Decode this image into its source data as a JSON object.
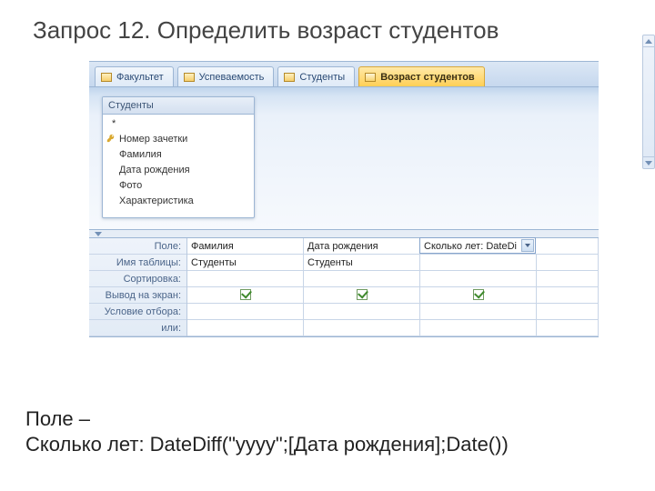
{
  "slide_title": "Запрос 12. Определить возраст студентов",
  "tabs": [
    {
      "label": "Факультет",
      "icon": "table-icon",
      "active": false
    },
    {
      "label": "Успеваемость",
      "icon": "table-icon",
      "active": false
    },
    {
      "label": "Студенты",
      "icon": "table-icon",
      "active": false
    },
    {
      "label": "Возраст студентов",
      "icon": "query-icon",
      "active": true
    }
  ],
  "source_table": {
    "title": "Студенты",
    "fields": [
      {
        "label": "*",
        "pk": false,
        "star": true
      },
      {
        "label": "Номер зачетки",
        "pk": true
      },
      {
        "label": "Фамилия",
        "pk": false
      },
      {
        "label": "Дата рождения",
        "pk": false
      },
      {
        "label": "Фото",
        "pk": false
      },
      {
        "label": "Характеристика",
        "pk": false
      }
    ]
  },
  "qbe": {
    "row_labels": [
      "Поле:",
      "Имя таблицы:",
      "Сортировка:",
      "Вывод на экран:",
      "Условие отбора:",
      "или:"
    ],
    "columns": [
      {
        "field": "Фамилия",
        "table": "Студенты",
        "show": true,
        "active": false
      },
      {
        "field": "Дата рождения",
        "table": "Студенты",
        "show": true,
        "active": false
      },
      {
        "field": "Сколько лет: DateDi",
        "table": "",
        "show": true,
        "active": true
      }
    ]
  },
  "footer": {
    "line1": "Поле –",
    "line2": "Сколько лет: DateDiff(\"yyyy\";[Дата рождения];Date())"
  }
}
